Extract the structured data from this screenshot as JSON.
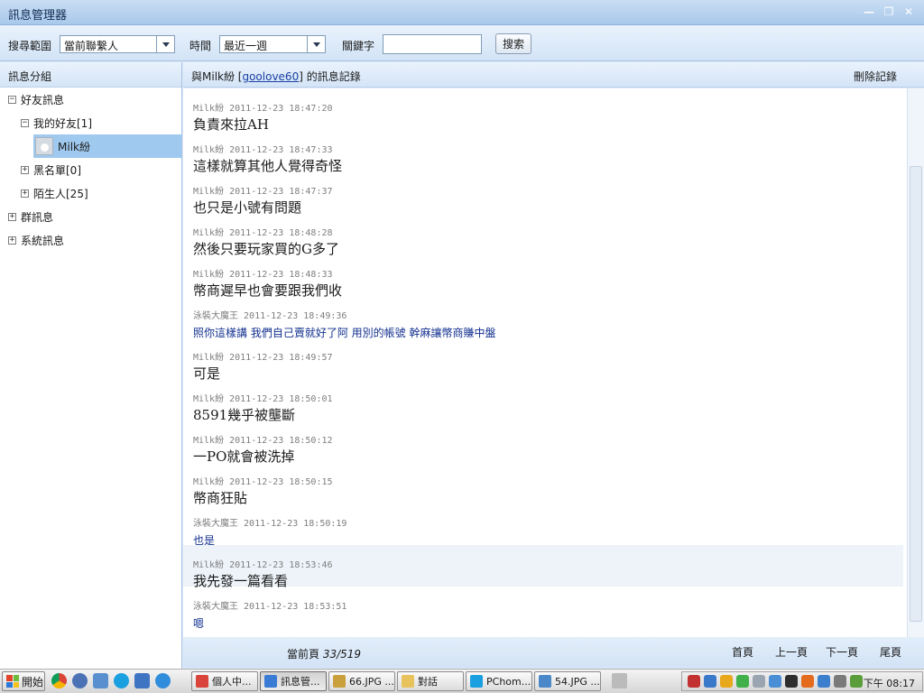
{
  "window": {
    "title": "訊息管理器",
    "buttons": {
      "minimize": "—",
      "restore": "❐",
      "close": "✕"
    }
  },
  "toolbar": {
    "scope_label": "搜尋範圍",
    "scope_value": "當前聯繫人",
    "time_label": "時間",
    "time_value": "最近一週",
    "keyword_label": "關鍵字",
    "keyword_value": "",
    "search_button": "搜索"
  },
  "sidebar": {
    "header": "訊息分組",
    "tree": {
      "friends": "好友訊息",
      "my_friends": "我的好友[1]",
      "contact": "Milk紛",
      "blacklist": "黑名單[0]",
      "strangers": "陌生人[25]",
      "groups": "群訊息",
      "system": "系統訊息",
      "expanded_glyph": "−",
      "collapsed_glyph": "+"
    }
  },
  "conversation": {
    "title_prefix": "與Milk紛 [",
    "contact_id": "goolove60",
    "title_suffix": "] 的訊息記錄",
    "delete_label": "刪除記錄"
  },
  "messages": [
    {
      "sender": "Milk紛",
      "time": "2011-12-23 18:47:20",
      "text": "負責來拉AH",
      "self": false,
      "highlight": false
    },
    {
      "sender": "Milk紛",
      "time": "2011-12-23 18:47:33",
      "text": "這樣就算其他人覺得奇怪",
      "self": false,
      "highlight": false
    },
    {
      "sender": "Milk紛",
      "time": "2011-12-23 18:47:37",
      "text": "也只是小號有問題",
      "self": false,
      "highlight": false
    },
    {
      "sender": "Milk紛",
      "time": "2011-12-23 18:48:28",
      "text": "然後只要玩家買的G多了",
      "self": false,
      "highlight": false
    },
    {
      "sender": "Milk紛",
      "time": "2011-12-23 18:48:33",
      "text": "幣商遲早也會要跟我們收",
      "self": false,
      "highlight": false
    },
    {
      "sender": "泳裝大魔王",
      "time": "2011-12-23 18:49:36",
      "text": "照你這樣講 我們自己賣就好了阿 用別的帳號 幹麻讓幣商賺中盤",
      "self": true,
      "highlight": false
    },
    {
      "sender": "Milk紛",
      "time": "2011-12-23 18:49:57",
      "text": "可是",
      "self": false,
      "highlight": false
    },
    {
      "sender": "Milk紛",
      "time": "2011-12-23 18:50:01",
      "text": "8591幾乎被壟斷",
      "self": false,
      "highlight": false
    },
    {
      "sender": "Milk紛",
      "time": "2011-12-23 18:50:12",
      "text": "一PO就會被洗掉",
      "self": false,
      "highlight": false
    },
    {
      "sender": "Milk紛",
      "time": "2011-12-23 18:50:15",
      "text": "幣商狂貼",
      "self": false,
      "highlight": false
    },
    {
      "sender": "泳裝大魔王",
      "time": "2011-12-23 18:50:19",
      "text": "也是",
      "self": true,
      "highlight": false
    },
    {
      "sender": "Milk紛",
      "time": "2011-12-23 18:53:46",
      "text": "我先發一篇看看",
      "self": false,
      "highlight": true
    },
    {
      "sender": "泳裝大魔王",
      "time": "2011-12-23 18:53:51",
      "text": "嗯",
      "self": true,
      "highlight": false
    }
  ],
  "footer": {
    "page_label": "當前頁",
    "page_value": "33/519",
    "first": "首頁",
    "prev": "上一頁",
    "next": "下一頁",
    "last": "尾頁"
  },
  "taskbar": {
    "start": "開始",
    "tasks": [
      {
        "label": "個人中...",
        "color": "#d9453a",
        "active": false
      },
      {
        "label": "訊息管...",
        "color": "#3a7bd5",
        "active": true
      },
      {
        "label": "66.JPG ...",
        "color": "#c9a03c",
        "active": false
      },
      {
        "label": "對話",
        "color": "#e8c25a",
        "active": false
      },
      {
        "label": "PChom...",
        "color": "#1aa0e0",
        "active": false
      },
      {
        "label": "54.JPG ...",
        "color": "#4b88c9",
        "active": false
      }
    ],
    "clock": "下午 08:17"
  },
  "colors": {
    "accent": "#9fc9ee",
    "self_text": "#12308f",
    "chrome": "#d3e4f6"
  }
}
